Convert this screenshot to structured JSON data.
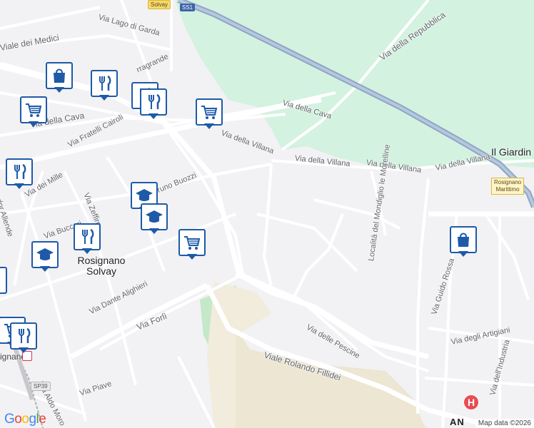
{
  "map": {
    "streets": [
      {
        "id": "via-lago-di-garda",
        "label": "Via Lago di Garda"
      },
      {
        "id": "viale-dei-medici",
        "label": "Viale dei Medici"
      },
      {
        "id": "via-della-cava-w",
        "label": "Via della Cava"
      },
      {
        "id": "via-della-cava-e",
        "label": "Via della Cava"
      },
      {
        "id": "via-fratelli-cairoli",
        "label": "Via Fratelli Cairoli"
      },
      {
        "id": "via-della-villana-1",
        "label": "Via della Villana"
      },
      {
        "id": "via-della-villana-2",
        "label": "Via della Villana"
      },
      {
        "id": "via-della-villana-3",
        "label": "Via della Villana"
      },
      {
        "id": "via-della-villana-4",
        "label": "Via della Villana"
      },
      {
        "id": "via-della-repubblica",
        "label": "Via della Repubblica"
      },
      {
        "id": "via-dei-mille",
        "label": "Via dei Mille"
      },
      {
        "id": "via-zeffiro",
        "label": "Via Zeffiro"
      },
      {
        "id": "via-bruno-buozzi",
        "label": "Bruno Buozzi"
      },
      {
        "id": "via-salvador-allende",
        "label": "vador Allende"
      },
      {
        "id": "via-buccari",
        "label": "Via Buccari"
      },
      {
        "id": "via-dante-alighieri",
        "label": "Via Dante Alighieri"
      },
      {
        "id": "via-forli",
        "label": "Via Forlì"
      },
      {
        "id": "viale-rolando-fillidei",
        "label": "Viale Rolando Fillidei"
      },
      {
        "id": "via-delle-pescine",
        "label": "Via delle Pescine"
      },
      {
        "id": "via-aldo-moro",
        "label": "Via Aldo Moro"
      },
      {
        "id": "via-piave",
        "label": "Via Piave"
      },
      {
        "id": "via-guido-rossa",
        "label": "Via Guido Rossa"
      },
      {
        "id": "via-degli-artigiani",
        "label": "Via degli Artigiani"
      },
      {
        "id": "via-dellindustria",
        "label": "Via dell'Industria"
      },
      {
        "id": "localita-mondiglio",
        "label": "Località del Mondiglio le Morelline"
      },
      {
        "id": "via-terragrande",
        "label": "rragrande"
      }
    ],
    "places": {
      "rosignano_solvay_line1": "Rosignano",
      "rosignano_solvay_line2": "Solvay",
      "il_giardino": "Il Giardin",
      "rosignano_sw": "ignano",
      "bottom_edge": "AN"
    },
    "shields": {
      "top": "Solvay",
      "ss1": "SS1",
      "sp39": "SP39"
    },
    "station": {
      "line1": "Rosignano",
      "line2": "Marittimo"
    },
    "pois": [
      {
        "id": "shopping-1",
        "type": "shopping-bag-icon"
      },
      {
        "id": "restaurant-1",
        "type": "restaurant-icon"
      },
      {
        "id": "restaurant-2",
        "type": "restaurant-icon"
      },
      {
        "id": "grocery-1",
        "type": "shopping-cart-icon"
      },
      {
        "id": "grocery-2",
        "type": "shopping-cart-icon"
      },
      {
        "id": "restaurant-3",
        "type": "restaurant-icon"
      },
      {
        "id": "school-1",
        "type": "school-icon"
      },
      {
        "id": "school-2",
        "type": "school-icon"
      },
      {
        "id": "restaurant-4",
        "type": "restaurant-icon"
      },
      {
        "id": "grocery-3",
        "type": "shopping-cart-icon"
      },
      {
        "id": "school-3",
        "type": "school-icon"
      },
      {
        "id": "restaurant-5",
        "type": "restaurant-icon"
      },
      {
        "id": "shopping-2",
        "type": "shopping-bag-icon"
      }
    ],
    "hospital_symbol": "H",
    "google_logo": "Google",
    "attribution": "Map data ©2026",
    "colors": {
      "land": "#f2f1f4",
      "park": "#d3f2e0",
      "green": "#c5e8c8",
      "sand": "#f1ecdb",
      "highway": "#8fa6c6",
      "road": "#ffffff",
      "poi_accent": "#1e5aa8",
      "hospital": "#e94b52"
    }
  }
}
